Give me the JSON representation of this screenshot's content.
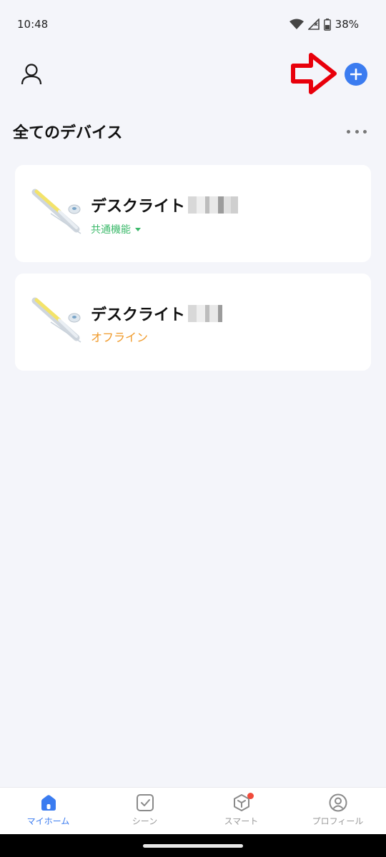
{
  "status_bar": {
    "time": "10:48",
    "battery": "38%"
  },
  "header": {
    "profile_icon": "person-icon",
    "add_icon": "plus-icon",
    "annotation_color": "#e8000b"
  },
  "section": {
    "title": "全てのデバイス",
    "more_icon": "more-horizontal-icon"
  },
  "devices": [
    {
      "name": "デスクライト",
      "status": "共通機能",
      "status_color": "#3bb96a"
    },
    {
      "name": "デスクライト",
      "status": "オフライン",
      "status_color": "#f09a2a"
    }
  ],
  "bottom_nav": {
    "items": [
      {
        "label": "マイホーム",
        "icon": "home-icon",
        "active": true
      },
      {
        "label": "シーン",
        "icon": "checkbox-icon",
        "active": false
      },
      {
        "label": "スマート",
        "icon": "cube-icon",
        "active": false
      },
      {
        "label": "プロフィール",
        "icon": "profile-circle-icon",
        "active": false
      }
    ],
    "accent": "#3b7cf0"
  }
}
